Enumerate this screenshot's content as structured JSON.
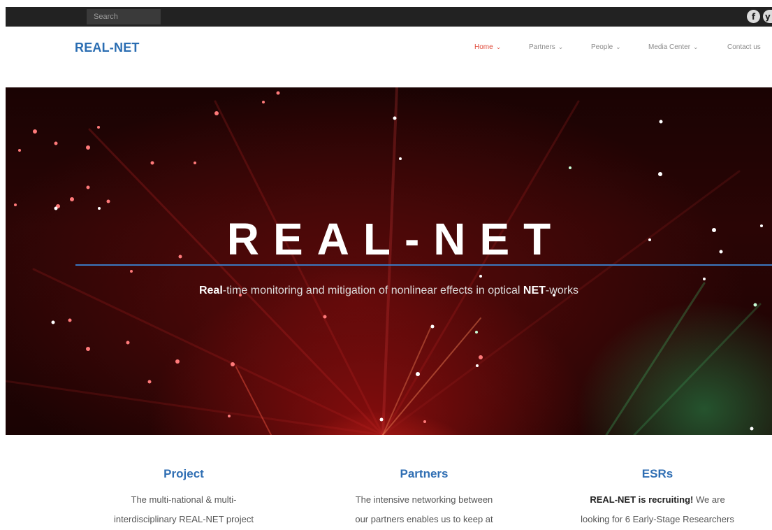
{
  "topbar": {
    "search_placeholder": "Search",
    "social": [
      {
        "icon": "facebook-icon",
        "glyph": "f"
      },
      {
        "icon": "twitter-icon",
        "glyph": "y"
      }
    ]
  },
  "header": {
    "brand": "REAL-NET",
    "nav": [
      {
        "label": "Home",
        "has_dropdown": true,
        "active": true
      },
      {
        "label": "Partners",
        "has_dropdown": true,
        "active": false
      },
      {
        "label": "People",
        "has_dropdown": true,
        "active": false
      },
      {
        "label": "Media Center",
        "has_dropdown": true,
        "active": false
      },
      {
        "label": "Contact us",
        "has_dropdown": false,
        "active": false
      }
    ],
    "chevron_glyph": "⌄"
  },
  "hero": {
    "title": "REAL-NET",
    "subtitle_bold_1": "Real",
    "subtitle_mid": "-time monitoring and mitigation of nonlinear effects in optical ",
    "subtitle_bold_2": "NET",
    "subtitle_end": "-works"
  },
  "columns": [
    {
      "title": "Project",
      "line1": "The multi-national & multi-",
      "line2": "interdisciplinary REAL-NET project"
    },
    {
      "title": "Partners",
      "line1": "The intensive networking between",
      "line2": "our partners enables us to keep at"
    },
    {
      "title": "ESRs",
      "line1_bold": "REAL-NET is recruiting!",
      "line1_rest": " We are",
      "line2": "looking for 6 Early-Stage Researchers"
    }
  ],
  "colors": {
    "brand_blue": "#2a6db2",
    "nav_active": "#e04a3a",
    "topbar": "#222222",
    "hero_line": "#3b78c0"
  }
}
